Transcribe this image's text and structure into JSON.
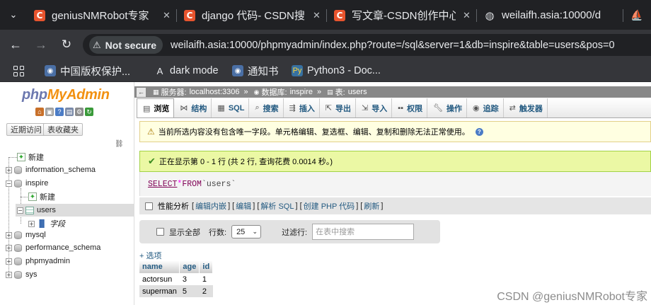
{
  "browser": {
    "tabs": [
      {
        "title": "geniusNMRobot专家",
        "favicon": "csdn-icon"
      },
      {
        "title": "django 代码- CSDN搜",
        "favicon": "csdn-icon"
      },
      {
        "title": "写文章-CSDN创作中心",
        "favicon": "csdn-icon"
      },
      {
        "title": "weilaifh.asia:10000/d",
        "favicon": "globe-icon"
      }
    ],
    "security_label": "Not secure",
    "url": "weilaifh.asia:10000/phpmyadmin/index.php?route=/sql&server=1&db=inspire&table=users&pos=0",
    "bookmarks": [
      {
        "label": "中国版权保护..."
      },
      {
        "label": "dark mode"
      },
      {
        "label": "通知书"
      },
      {
        "label": "Python3 - Doc..."
      }
    ]
  },
  "pma_nav": {
    "logo_php": "php",
    "logo_myadmin": "MyAdmin",
    "buttons": {
      "recent": "近期访问",
      "favorites": "表收藏夹"
    },
    "tree": {
      "new": "新建",
      "information_schema": "information_schema",
      "inspire": "inspire",
      "inspire_new": "新建",
      "users": "users",
      "fields": "字段",
      "mysql": "mysql",
      "performance_schema": "performance_schema",
      "phpmyadmin": "phpmyadmin",
      "sys": "sys"
    }
  },
  "breadcrumb": {
    "server_label": "服务器:",
    "server": "localhost:3306",
    "db_label": "数据库:",
    "db": "inspire",
    "table_label": "表:",
    "table": "users",
    "separator": "»"
  },
  "menu": {
    "browse": "浏览",
    "structure": "结构",
    "sql": "SQL",
    "search": "搜索",
    "insert": "插入",
    "export": "导出",
    "import": "导入",
    "privileges": "权限",
    "operations": "操作",
    "tracking": "追踪",
    "triggers": "触发器"
  },
  "notice": "当前所选内容没有包含唯一字段。单元格编辑、复选框、编辑、复制和删除无法正常使用。",
  "success": "正在显示第 0 - 1 行 (共 2 行, 查询花费 0.0014 秒。)",
  "sql": {
    "select": "SELECT",
    "star": "*",
    "from": "FROM",
    "table": "`users`"
  },
  "query_tools": {
    "profiling": "性能分析",
    "edit_inline": "编辑内嵌",
    "edit": "编辑",
    "explain": "解析 SQL",
    "create_php": "创建 PHP 代码",
    "refresh": "刷新"
  },
  "nav_table": {
    "show_all": "显示全部",
    "rows_label": "行数:",
    "rows_value": "25",
    "filter_label": "过滤行:",
    "filter_placeholder": "在表中搜索"
  },
  "options_link": "+ 选项",
  "results": {
    "columns": [
      "name",
      "age",
      "id"
    ],
    "rows": [
      [
        "actorsun",
        "3",
        "1"
      ],
      [
        "superman",
        "5",
        "2"
      ]
    ]
  },
  "watermark": "CSDN @geniusNMRobot专家"
}
